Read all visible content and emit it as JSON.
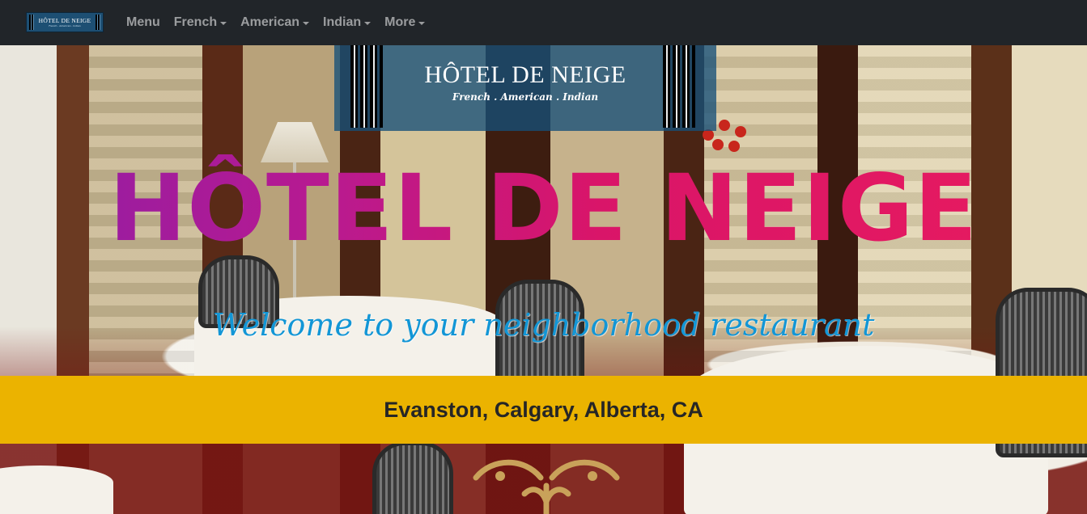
{
  "navbar": {
    "brand": {
      "title": "HÔTEL DE NEIGE",
      "subtitle": "French . American . Indian"
    },
    "items": [
      {
        "label": "Menu",
        "dropdown": false
      },
      {
        "label": "French",
        "dropdown": true
      },
      {
        "label": "American",
        "dropdown": true
      },
      {
        "label": "Indian",
        "dropdown": true
      },
      {
        "label": "More",
        "dropdown": true
      }
    ]
  },
  "hero": {
    "logo": {
      "title": "HÔTEL DE NEIGE",
      "subtitle": "French . American . Indian"
    },
    "heading": "HÔTEL DE NEIGE",
    "tagline": "Welcome to your neighborhood restaurant",
    "location": "Evanston, Calgary, Alberta, CA"
  },
  "colors": {
    "navbar": "#212529",
    "location_bar": "#ebb300",
    "tagline": "#1296d6",
    "heading_start": "#8f1da6",
    "heading_end": "#e81b5e"
  }
}
